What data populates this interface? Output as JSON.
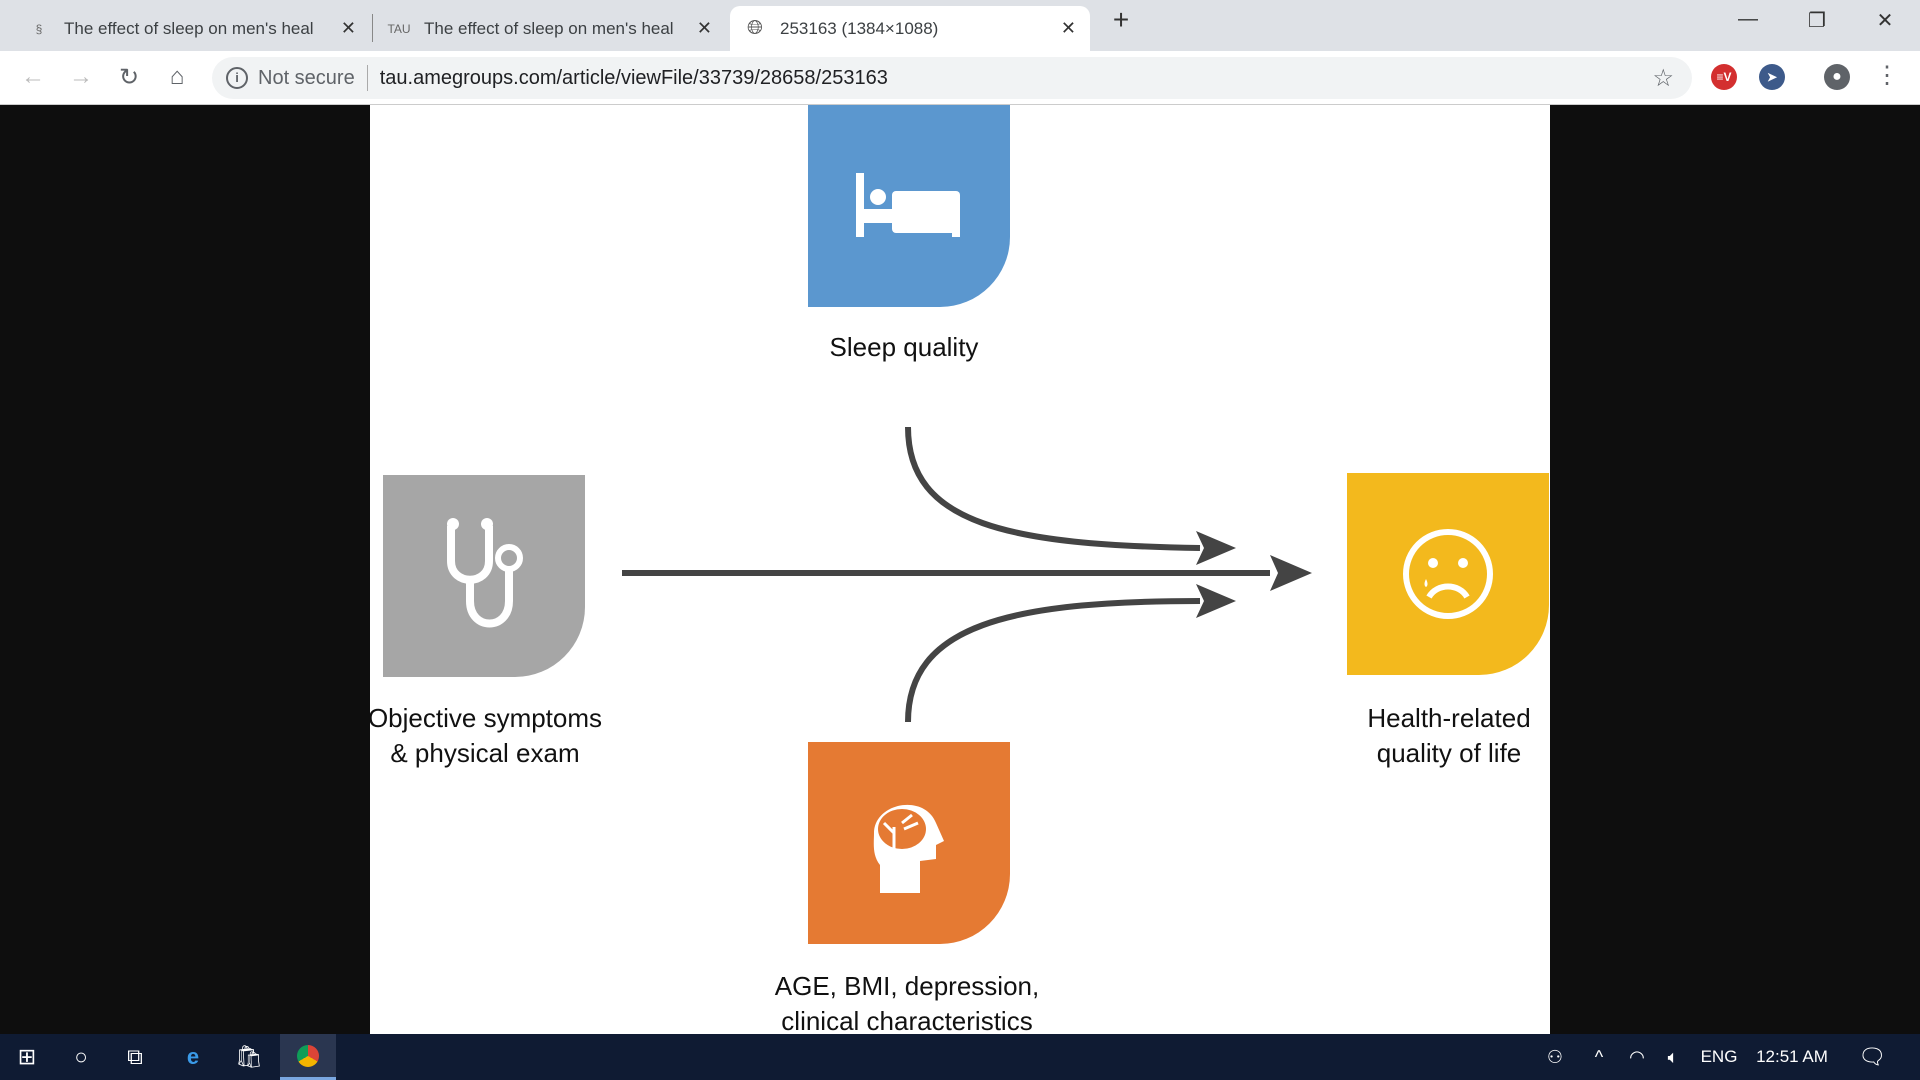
{
  "browser": {
    "tabs": [
      {
        "title": "The effect of sleep on men's heal",
        "icon": "site-logo-icon"
      },
      {
        "title": "The effect of sleep on men's heal",
        "icon_text": "TAU"
      },
      {
        "title": "253163 (1384×1088)",
        "icon": "globe-icon",
        "active": true
      }
    ],
    "security": "Not secure",
    "url": "tau.amegroups.com/article/viewFile/33739/28658/253163"
  },
  "diagram": {
    "nodes": [
      {
        "label": "Sleep quality",
        "icon": "bed-icon",
        "color": "#5b97cf"
      },
      {
        "label_lines": [
          "Objective symptoms",
          "& physical exam"
        ],
        "icon": "stethoscope-icon",
        "color": "#a6a6a6"
      },
      {
        "label_lines": [
          "Health-related",
          "quality of life"
        ],
        "icon": "sad-face-icon",
        "color": "#f3b91d"
      },
      {
        "label_lines": [
          "AGE, BMI, depression,",
          "clinical characteristics"
        ],
        "icon": "head-brain-icon",
        "color": "#e57a33"
      }
    ],
    "arrow_color": "#444444"
  },
  "taskbar": {
    "lang": "ENG",
    "time": "12:51 AM"
  }
}
